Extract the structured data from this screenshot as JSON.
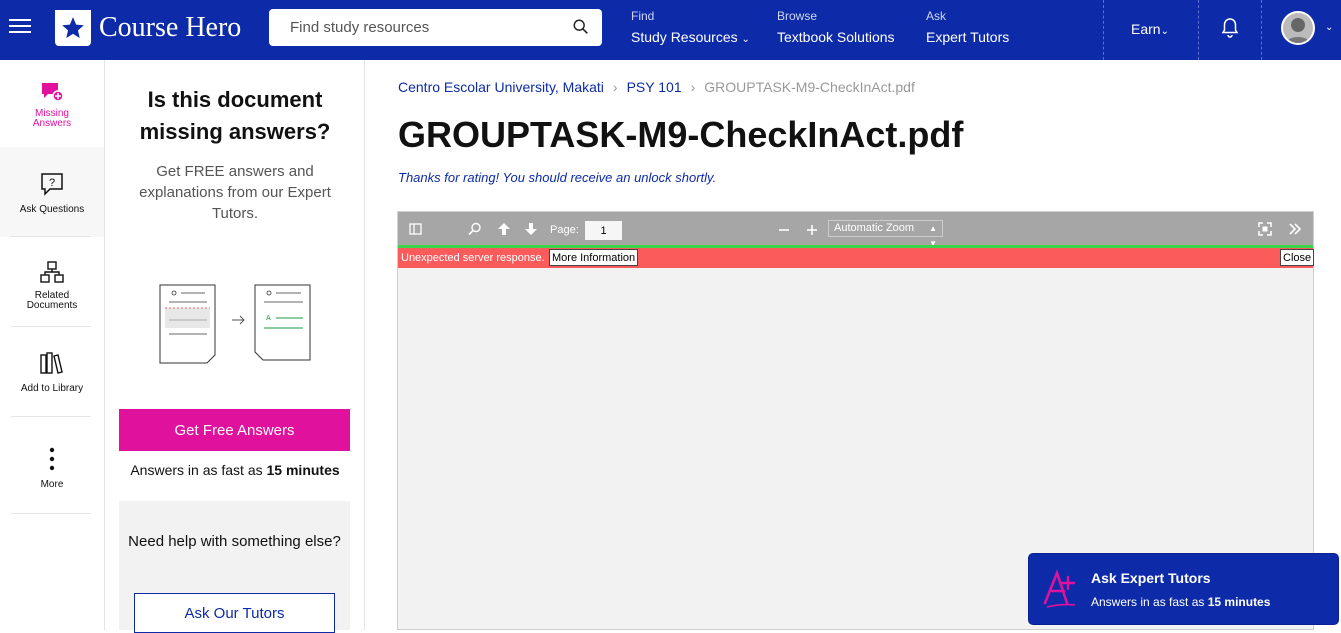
{
  "header": {
    "brand": "Course Hero",
    "search_placeholder": "Find study resources",
    "nav": [
      {
        "caption": "Find",
        "label": "Study Resources"
      },
      {
        "caption": "Browse",
        "label": "Textbook Solutions"
      },
      {
        "caption": "Ask",
        "label": "Expert Tutors"
      }
    ],
    "earn_label": "Earn",
    "accent_color": "#0d2ba8"
  },
  "rail": {
    "items": [
      {
        "label_line1": "Missing",
        "label_line2": "Answers",
        "icon": "missing-answers-icon"
      },
      {
        "label_line1": "Ask Questions",
        "label_line2": "",
        "icon": "ask-question-icon"
      },
      {
        "label_line1": "Related",
        "label_line2": "Documents",
        "icon": "related-documents-icon"
      },
      {
        "label_line1": "Add to Library",
        "label_line2": "",
        "icon": "library-icon"
      },
      {
        "label_line1": "More",
        "label_line2": "",
        "icon": "more-icon"
      }
    ]
  },
  "panel": {
    "title": "Is this document missing answers?",
    "subtitle": "Get FREE answers and explanations from our Expert Tutors.",
    "cta_label": "Get Free Answers",
    "fast_prefix": "Answers in as fast as ",
    "fast_time": "15 minutes",
    "help_question": "Need help with something else?",
    "tutors_button": "Ask Our Tutors",
    "cta_color": "#e0119d"
  },
  "breadcrumb": {
    "school": "Centro Escolar University, Makati",
    "course": "PSY 101",
    "current": "GROUPTASK-M9-CheckInAct.pdf"
  },
  "document": {
    "title": "GROUPTASK-M9-CheckInAct.pdf",
    "rating_message": "Thanks for rating! You should receive an unlock shortly."
  },
  "viewer": {
    "page_label": "Page:",
    "page_value": "1",
    "zoom": "Automatic Zoom",
    "error_message": "Unexpected server response.",
    "more_info": "More Information",
    "close": "Close"
  },
  "floating": {
    "title": "Ask Expert Tutors",
    "subtitle_prefix": "Answers in as fast as ",
    "subtitle_time": "15 minutes"
  }
}
